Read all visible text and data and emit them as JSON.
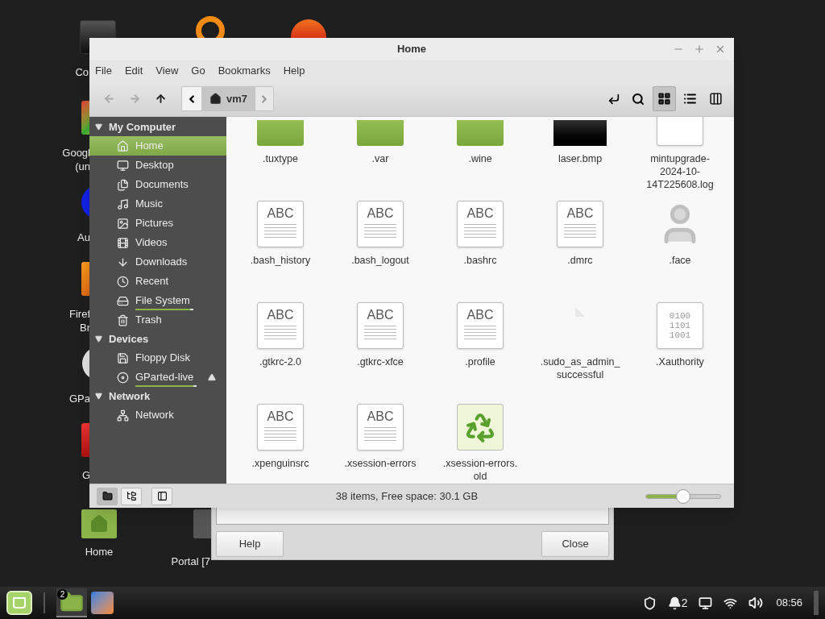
{
  "desktop": {
    "icons": [
      {
        "kind": "terminal",
        "label_lines": [
          "Co"
        ]
      },
      {
        "kind": "ring"
      },
      {
        "kind": "fire"
      },
      {
        "kind": "chrome",
        "label_lines": [
          "Googl",
          "(un"
        ]
      },
      {
        "kind": "blue",
        "label_lines": [
          "Au"
        ]
      },
      {
        "kind": "firefox",
        "label_lines": [
          "Firef",
          "Br"
        ]
      },
      {
        "kind": "disc",
        "label_lines": [
          "GPa"
        ]
      },
      {
        "kind": "red",
        "label_lines": [
          "G"
        ]
      },
      {
        "kind": "home",
        "label_lines": [
          "Home"
        ]
      },
      {
        "kind": "portal",
        "label_lines": [
          "Portal [7"
        ]
      }
    ]
  },
  "dialog": {
    "buttons": [
      "Help",
      "Close"
    ]
  },
  "window": {
    "title": "Home",
    "menu": [
      "File",
      "Edit",
      "View",
      "Go",
      "Bookmarks",
      "Help"
    ],
    "nav": [
      {
        "kind": "back",
        "disabled": true
      },
      {
        "kind": "forward",
        "disabled": true
      },
      {
        "kind": "up",
        "disabled": false
      }
    ],
    "path": [
      {
        "label": "vm7",
        "selected": true
      }
    ],
    "views": [
      {
        "kind": "icons",
        "selected": true
      },
      {
        "kind": "list",
        "selected": false
      },
      {
        "kind": "compact",
        "selected": false
      }
    ],
    "sidebar": [
      {
        "title": "My Computer",
        "expanded": true,
        "items": [
          {
            "kind": "home",
            "label": "Home",
            "selected": true
          },
          {
            "kind": "desktop",
            "label": "Desktop",
            "selected": false
          },
          {
            "kind": "documents",
            "label": "Documents",
            "selected": false
          },
          {
            "kind": "music",
            "label": "Music",
            "selected": false
          },
          {
            "kind": "pictures",
            "label": "Pictures",
            "selected": false
          },
          {
            "kind": "videos",
            "label": "Videos",
            "selected": false
          },
          {
            "kind": "downloads",
            "label": "Downloads",
            "selected": false
          },
          {
            "kind": "recent",
            "label": "Recent",
            "selected": false
          },
          {
            "kind": "drive",
            "label": "File System",
            "selected": false,
            "level": 0.95
          },
          {
            "kind": "trash",
            "label": "Trash",
            "selected": false
          }
        ]
      },
      {
        "title": "Devices",
        "expanded": true,
        "items": [
          {
            "kind": "floppy",
            "label": "Floppy Disk",
            "selected": false
          },
          {
            "kind": "disc",
            "label": "GParted-live",
            "selected": false,
            "level": 0.95,
            "eject": true
          }
        ]
      },
      {
        "title": "Network",
        "expanded": true,
        "items": [
          {
            "kind": "network",
            "label": "Network",
            "selected": false
          }
        ]
      }
    ],
    "files": [
      {
        "kind": "folder",
        "name": ".tuxtype"
      },
      {
        "kind": "folder",
        "name": ".var"
      },
      {
        "kind": "folder",
        "name": ".wine"
      },
      {
        "kind": "image",
        "name": "laser.bmp"
      },
      {
        "kind": "text",
        "name": "mintupgrade-2024-10-14T225608.log"
      },
      {
        "kind": "text",
        "name": ".bash_history",
        "preview": "ABC"
      },
      {
        "kind": "text",
        "name": ".bash_logout",
        "preview": "ABC"
      },
      {
        "kind": "text",
        "name": ".bashrc",
        "preview": "ABC"
      },
      {
        "kind": "text",
        "name": ".dmrc",
        "preview": "ABC"
      },
      {
        "kind": "person",
        "name": ".face"
      },
      {
        "kind": "text",
        "name": ".gtkrc-2.0",
        "preview": "ABC"
      },
      {
        "kind": "text",
        "name": ".gtkrc-xfce",
        "preview": "ABC"
      },
      {
        "kind": "text",
        "name": ".profile",
        "preview": "ABC"
      },
      {
        "kind": "empty",
        "name": ".sudo_as_admin_successful"
      },
      {
        "kind": "binary",
        "name": ".Xauthority",
        "preview_lines": [
          "0100",
          "1101",
          "1001"
        ]
      },
      {
        "kind": "text",
        "name": ".xpenguinsrc",
        "preview": "ABC"
      },
      {
        "kind": "text",
        "name": ".xsession-errors",
        "preview": "ABC"
      },
      {
        "kind": "recycle",
        "name": ".xsession-errors.old"
      }
    ],
    "status": {
      "panes": [
        {
          "kind": "places",
          "selected": true
        },
        {
          "kind": "tree",
          "selected": false
        }
      ],
      "text": "38 items, Free space: 30.1 GB",
      "zoom": {
        "level": 0.5
      }
    }
  },
  "taskbar": {
    "launchers": [
      {
        "kind": "menu"
      },
      {
        "kind": "files",
        "badge": "2",
        "active": true
      },
      {
        "kind": "firefox",
        "active": false
      }
    ],
    "tray": [
      {
        "kind": "shield"
      },
      {
        "kind": "notifications",
        "text": "2"
      },
      {
        "kind": "screen"
      },
      {
        "kind": "network"
      },
      {
        "kind": "volume"
      }
    ],
    "clock": "08:56"
  }
}
